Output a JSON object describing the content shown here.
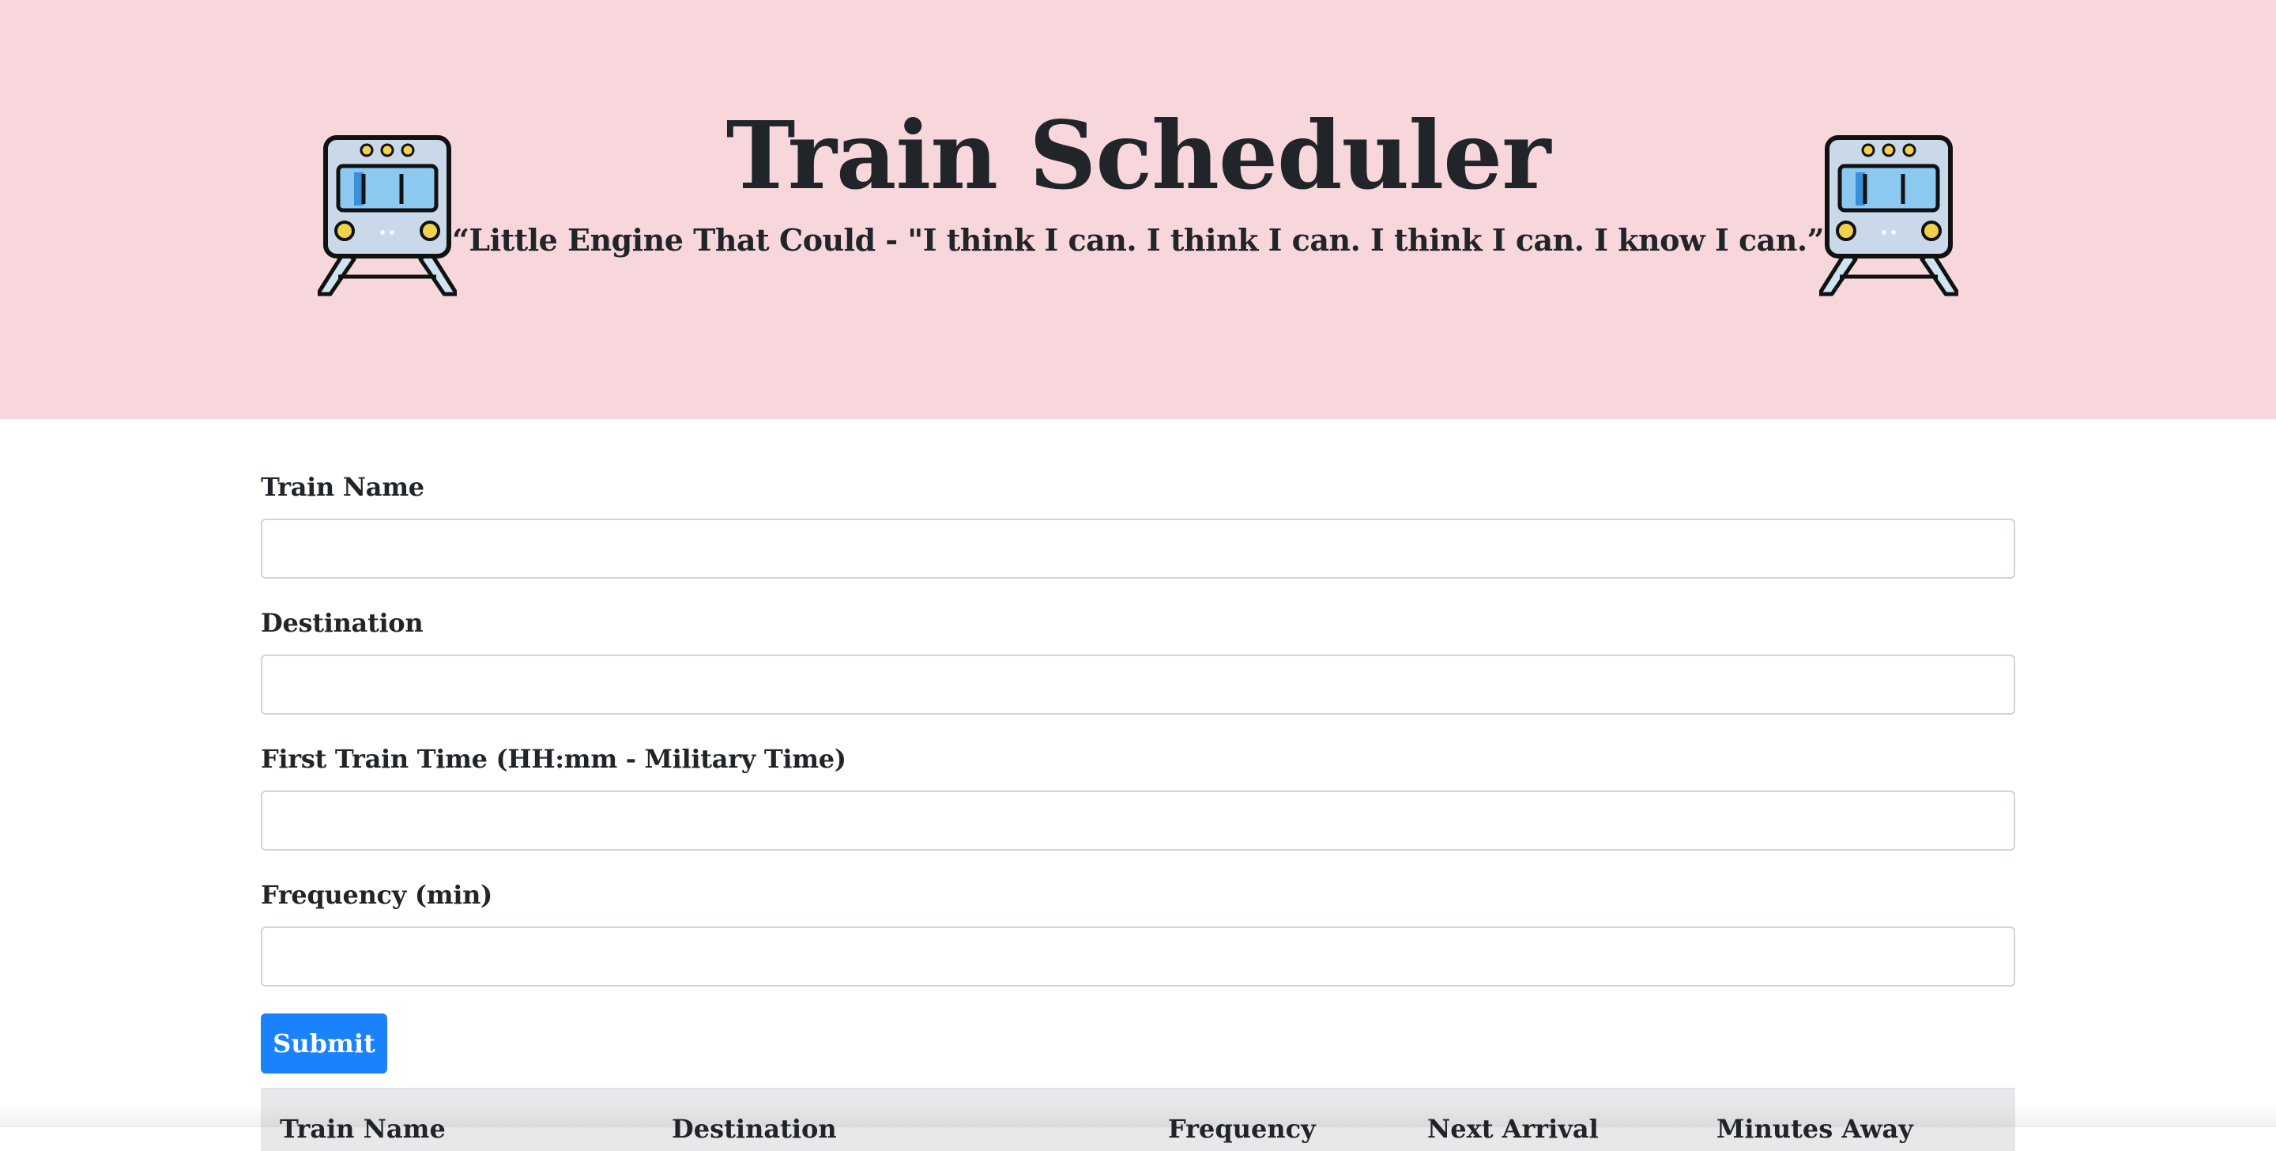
{
  "header": {
    "title": "Train Scheduler",
    "subtitle": "“Little Engine That Could - \"I think I can. I think I can. I think I can. I know I can.”",
    "background_color": "#f8d7dc",
    "left_icon": "train-icon",
    "right_icon": "train-icon"
  },
  "form": {
    "fields": [
      {
        "label": "Train Name",
        "value": "",
        "placeholder": ""
      },
      {
        "label": "Destination",
        "value": "",
        "placeholder": ""
      },
      {
        "label": "First Train Time (HH:mm - Military Time)",
        "value": "",
        "placeholder": ""
      },
      {
        "label": "Frequency (min)",
        "value": "",
        "placeholder": ""
      }
    ],
    "submit_label": "Submit",
    "submit_color": "#1a82fb"
  },
  "table": {
    "columns": [
      "Train Name",
      "Destination",
      "Frequency",
      "Next Arrival",
      "Minutes Away"
    ],
    "rows": []
  }
}
